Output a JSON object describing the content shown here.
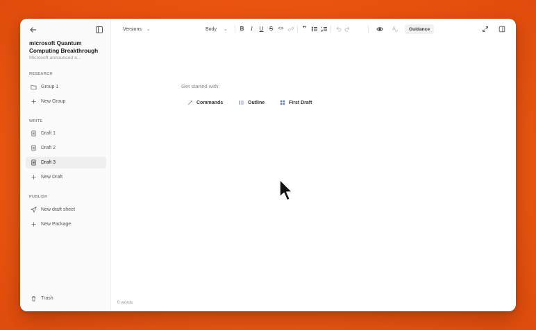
{
  "window": {
    "doc_title": "microsoft Quantum Computing Breakthrough",
    "doc_subtitle": "Microsoft announced a..."
  },
  "sidebar": {
    "sections": {
      "research": "RESEARCH",
      "write": "WRITE",
      "publish": "PUBLISH"
    },
    "research_items": [
      {
        "label": "Group 1",
        "icon": "folder-icon"
      },
      {
        "label": "New Group",
        "icon": "plus-icon"
      }
    ],
    "write_items": [
      {
        "label": "Draft 1",
        "icon": "document-icon"
      },
      {
        "label": "Draft 2",
        "icon": "document-icon"
      },
      {
        "label": "Draft 3",
        "icon": "document-icon",
        "active": true
      },
      {
        "label": "New Draft",
        "icon": "plus-icon"
      }
    ],
    "publish_items": [
      {
        "label": "New draft sheet",
        "icon": "send-icon"
      },
      {
        "label": "New Package",
        "icon": "plus-icon"
      }
    ],
    "trash_label": "Trash"
  },
  "toolbar": {
    "versions_label": "Versions",
    "style_select": "Body",
    "guidance_label": "Guidance"
  },
  "editor": {
    "get_started": "Get started with:",
    "options": [
      {
        "label": "Commands",
        "icon": "wand-icon"
      },
      {
        "label": "Outline",
        "icon": "list-icon"
      },
      {
        "label": "First Draft",
        "icon": "grid-icon"
      }
    ],
    "word_count": "0 words"
  },
  "colors": {
    "background": "#ee5a14",
    "window": "#ffffff",
    "sidebar": "#fbfbfb",
    "option_icon": "#7080b8"
  }
}
